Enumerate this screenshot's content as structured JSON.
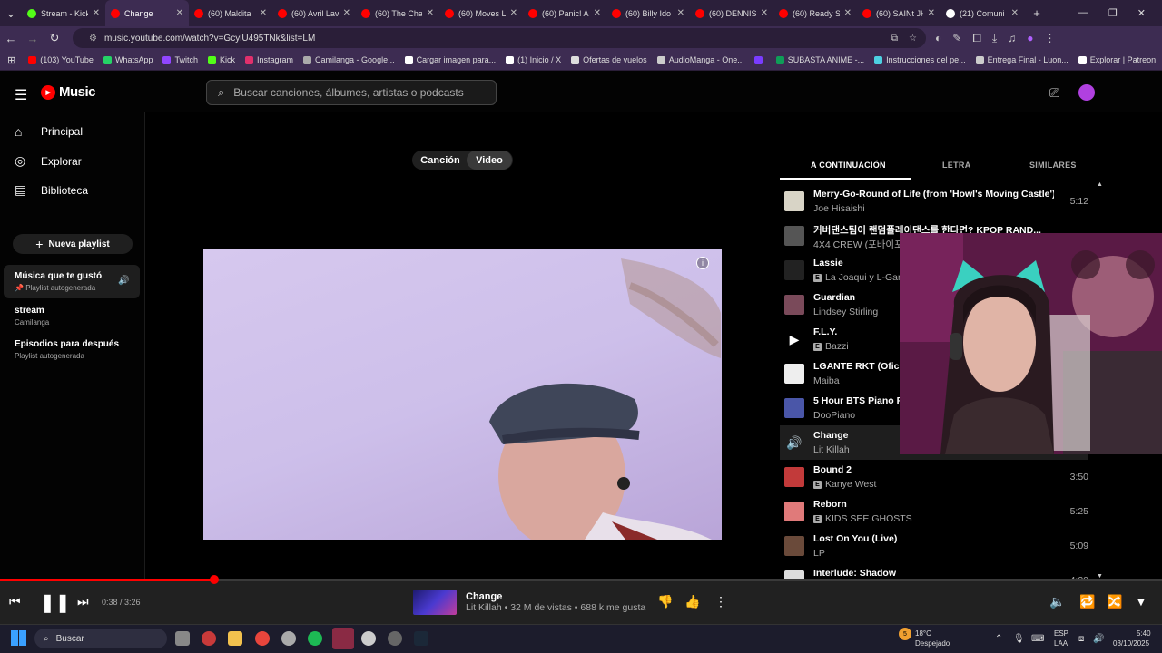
{
  "browser": {
    "tabs": [
      {
        "label": "Stream - Kick",
        "fav": "#53fc18"
      },
      {
        "label": "Change",
        "fav": "#ff0000"
      },
      {
        "label": "(60) Maldita",
        "fav": "#ff0000"
      },
      {
        "label": "(60) Avril Lav",
        "fav": "#ff0000"
      },
      {
        "label": "(60) The Cha",
        "fav": "#ff0000"
      },
      {
        "label": "(60) Moves L",
        "fav": "#ff0000"
      },
      {
        "label": "(60) Panic! A",
        "fav": "#ff0000"
      },
      {
        "label": "(60) Billy Ido",
        "fav": "#ff0000"
      },
      {
        "label": "(60) DENNIS",
        "fav": "#ff0000"
      },
      {
        "label": "(60) Ready S",
        "fav": "#ff0000"
      },
      {
        "label": "(60) SAINt JH",
        "fav": "#ff0000"
      },
      {
        "label": "(21) Comuni",
        "fav": "#ffffff"
      }
    ],
    "url": "music.youtube.com/watch?v=GcyiU495TNk&list=LM",
    "bookmarks": [
      {
        "label": "(103) YouTube",
        "color": "#ff0000"
      },
      {
        "label": "WhatsApp",
        "color": "#25d366"
      },
      {
        "label": "Twitch",
        "color": "#9146ff"
      },
      {
        "label": "Kick",
        "color": "#53fc18"
      },
      {
        "label": "Instagram",
        "color": "#e1306c"
      },
      {
        "label": "Camilanga - Google...",
        "color": "#aaaaaa"
      },
      {
        "label": "Cargar imagen para...",
        "color": "#ffffff"
      },
      {
        "label": "(1) Inicio / X",
        "color": "#ffffff"
      },
      {
        "label": "Ofertas de vuelos",
        "color": "#dddddd"
      },
      {
        "label": "AudioManga - One...",
        "color": "#cccccc"
      },
      {
        "label": "",
        "color": "#7a3cff"
      },
      {
        "label": "SUBASTA ANIME -...",
        "color": "#0f9d58"
      },
      {
        "label": "Instrucciones del pe...",
        "color": "#4dd0e1"
      },
      {
        "label": "Entrega Final - Luon...",
        "color": "#cccccc"
      },
      {
        "label": "Explorar | Patreon",
        "color": "#ffffff"
      }
    ]
  },
  "header": {
    "logo": "Music",
    "search_placeholder": "Buscar canciones, álbumes, artistas o podcasts"
  },
  "sidebar": {
    "nav": [
      {
        "label": "Principal",
        "icon": "home-icon"
      },
      {
        "label": "Explorar",
        "icon": "compass-icon"
      },
      {
        "label": "Biblioteca",
        "icon": "library-icon"
      }
    ],
    "new_playlist": "Nueva playlist",
    "playlists": [
      {
        "title": "Música que te gustó",
        "sub": "Playlist autogenerada"
      },
      {
        "title": "stream",
        "sub": "Camilanga"
      },
      {
        "title": "Episodios para después",
        "sub": "Playlist autogenerada"
      }
    ]
  },
  "main": {
    "toggle": {
      "song": "Canción",
      "video": "Video"
    }
  },
  "panel": {
    "tabs": [
      "A CONTINUACIÓN",
      "LETRA",
      "SIMILARES"
    ],
    "queue": [
      {
        "title": "Merry-Go-Round of Life (from 'Howl's Moving Castle')",
        "artist": "Joe Hisaishi",
        "duration": "5:12",
        "explicit": false,
        "color": "#d8d4c6"
      },
      {
        "title": "커버댄스팀이 랜덤플레이댄스를 한다면? KPOP RAND...",
        "artist": "4X4 CREW (포바이포",
        "duration": "",
        "explicit": false,
        "color": "#555555"
      },
      {
        "title": "Lassie",
        "artist": "La Joaqui y L-Gan",
        "duration": "",
        "explicit": true,
        "color": "#222222"
      },
      {
        "title": "Guardian",
        "artist": "Lindsey Stirling",
        "duration": "",
        "explicit": false,
        "color": "#7a4a5a"
      },
      {
        "title": "F.L.Y.",
        "artist": "Bazzi",
        "duration": "",
        "explicit": true,
        "color": "#000000"
      },
      {
        "title": "LGANTE RKT (Oficia",
        "artist": "Maiba",
        "duration": "",
        "explicit": false,
        "color": "#eeeeee"
      },
      {
        "title": "5 Hour BTS Piano Pl",
        "artist": "DooPiano",
        "duration": "",
        "explicit": false,
        "color": "#4a56a8"
      },
      {
        "title": "Change",
        "artist": "Lit Killah",
        "duration": "",
        "explicit": false,
        "color": "#1e1e1e"
      },
      {
        "title": "Bound 2",
        "artist": "Kanye West",
        "duration": "3:50",
        "explicit": true,
        "color": "#c23a3a"
      },
      {
        "title": "Reborn",
        "artist": "KIDS SEE GHOSTS",
        "duration": "5:25",
        "explicit": true,
        "color": "#e07a7a"
      },
      {
        "title": "Lost On You (Live)",
        "artist": "LP",
        "duration": "5:09",
        "explicit": false,
        "color": "#6a4a3a"
      },
      {
        "title": "Interlude: Shadow",
        "artist": "",
        "duration": "4:20",
        "explicit": false,
        "color": "#dddddd"
      }
    ]
  },
  "player": {
    "progress": 0.1845,
    "time": "0:38 / 3:26",
    "title": "Change",
    "subtitle": "Lit Killah • 32 M de vistas • 688 k me gusta"
  },
  "taskbar": {
    "search": "Buscar",
    "weather_badge": "5",
    "temp": "18°C",
    "weather": "Despejado",
    "lang": "ESP",
    "region": "LAA",
    "clock": "5:40",
    "date": "03/10/2025"
  }
}
